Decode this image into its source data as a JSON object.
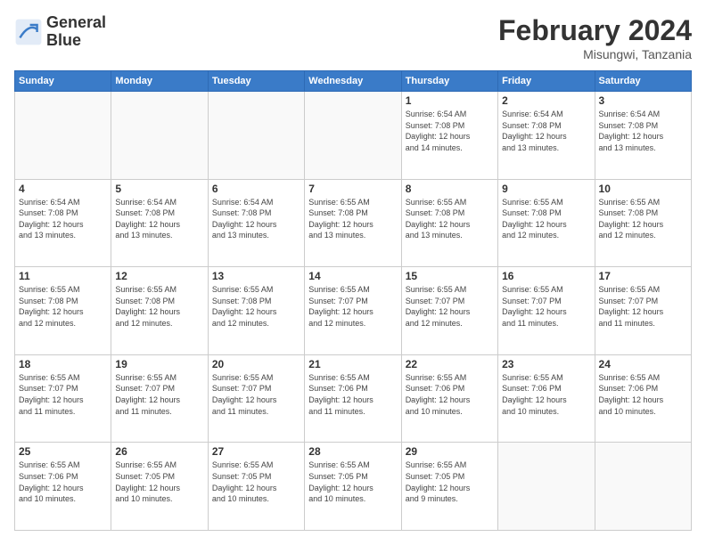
{
  "logo": {
    "line1": "General",
    "line2": "Blue"
  },
  "title": "February 2024",
  "location": "Misungwi, Tanzania",
  "days_header": [
    "Sunday",
    "Monday",
    "Tuesday",
    "Wednesday",
    "Thursday",
    "Friday",
    "Saturday"
  ],
  "weeks": [
    [
      {
        "day": "",
        "info": ""
      },
      {
        "day": "",
        "info": ""
      },
      {
        "day": "",
        "info": ""
      },
      {
        "day": "",
        "info": ""
      },
      {
        "day": "1",
        "info": "Sunrise: 6:54 AM\nSunset: 7:08 PM\nDaylight: 12 hours\nand 14 minutes."
      },
      {
        "day": "2",
        "info": "Sunrise: 6:54 AM\nSunset: 7:08 PM\nDaylight: 12 hours\nand 13 minutes."
      },
      {
        "day": "3",
        "info": "Sunrise: 6:54 AM\nSunset: 7:08 PM\nDaylight: 12 hours\nand 13 minutes."
      }
    ],
    [
      {
        "day": "4",
        "info": "Sunrise: 6:54 AM\nSunset: 7:08 PM\nDaylight: 12 hours\nand 13 minutes."
      },
      {
        "day": "5",
        "info": "Sunrise: 6:54 AM\nSunset: 7:08 PM\nDaylight: 12 hours\nand 13 minutes."
      },
      {
        "day": "6",
        "info": "Sunrise: 6:54 AM\nSunset: 7:08 PM\nDaylight: 12 hours\nand 13 minutes."
      },
      {
        "day": "7",
        "info": "Sunrise: 6:55 AM\nSunset: 7:08 PM\nDaylight: 12 hours\nand 13 minutes."
      },
      {
        "day": "8",
        "info": "Sunrise: 6:55 AM\nSunset: 7:08 PM\nDaylight: 12 hours\nand 13 minutes."
      },
      {
        "day": "9",
        "info": "Sunrise: 6:55 AM\nSunset: 7:08 PM\nDaylight: 12 hours\nand 12 minutes."
      },
      {
        "day": "10",
        "info": "Sunrise: 6:55 AM\nSunset: 7:08 PM\nDaylight: 12 hours\nand 12 minutes."
      }
    ],
    [
      {
        "day": "11",
        "info": "Sunrise: 6:55 AM\nSunset: 7:08 PM\nDaylight: 12 hours\nand 12 minutes."
      },
      {
        "day": "12",
        "info": "Sunrise: 6:55 AM\nSunset: 7:08 PM\nDaylight: 12 hours\nand 12 minutes."
      },
      {
        "day": "13",
        "info": "Sunrise: 6:55 AM\nSunset: 7:08 PM\nDaylight: 12 hours\nand 12 minutes."
      },
      {
        "day": "14",
        "info": "Sunrise: 6:55 AM\nSunset: 7:07 PM\nDaylight: 12 hours\nand 12 minutes."
      },
      {
        "day": "15",
        "info": "Sunrise: 6:55 AM\nSunset: 7:07 PM\nDaylight: 12 hours\nand 12 minutes."
      },
      {
        "day": "16",
        "info": "Sunrise: 6:55 AM\nSunset: 7:07 PM\nDaylight: 12 hours\nand 11 minutes."
      },
      {
        "day": "17",
        "info": "Sunrise: 6:55 AM\nSunset: 7:07 PM\nDaylight: 12 hours\nand 11 minutes."
      }
    ],
    [
      {
        "day": "18",
        "info": "Sunrise: 6:55 AM\nSunset: 7:07 PM\nDaylight: 12 hours\nand 11 minutes."
      },
      {
        "day": "19",
        "info": "Sunrise: 6:55 AM\nSunset: 7:07 PM\nDaylight: 12 hours\nand 11 minutes."
      },
      {
        "day": "20",
        "info": "Sunrise: 6:55 AM\nSunset: 7:07 PM\nDaylight: 12 hours\nand 11 minutes."
      },
      {
        "day": "21",
        "info": "Sunrise: 6:55 AM\nSunset: 7:06 PM\nDaylight: 12 hours\nand 11 minutes."
      },
      {
        "day": "22",
        "info": "Sunrise: 6:55 AM\nSunset: 7:06 PM\nDaylight: 12 hours\nand 10 minutes."
      },
      {
        "day": "23",
        "info": "Sunrise: 6:55 AM\nSunset: 7:06 PM\nDaylight: 12 hours\nand 10 minutes."
      },
      {
        "day": "24",
        "info": "Sunrise: 6:55 AM\nSunset: 7:06 PM\nDaylight: 12 hours\nand 10 minutes."
      }
    ],
    [
      {
        "day": "25",
        "info": "Sunrise: 6:55 AM\nSunset: 7:06 PM\nDaylight: 12 hours\nand 10 minutes."
      },
      {
        "day": "26",
        "info": "Sunrise: 6:55 AM\nSunset: 7:05 PM\nDaylight: 12 hours\nand 10 minutes."
      },
      {
        "day": "27",
        "info": "Sunrise: 6:55 AM\nSunset: 7:05 PM\nDaylight: 12 hours\nand 10 minutes."
      },
      {
        "day": "28",
        "info": "Sunrise: 6:55 AM\nSunset: 7:05 PM\nDaylight: 12 hours\nand 10 minutes."
      },
      {
        "day": "29",
        "info": "Sunrise: 6:55 AM\nSunset: 7:05 PM\nDaylight: 12 hours\nand 9 minutes."
      },
      {
        "day": "",
        "info": ""
      },
      {
        "day": "",
        "info": ""
      }
    ]
  ]
}
